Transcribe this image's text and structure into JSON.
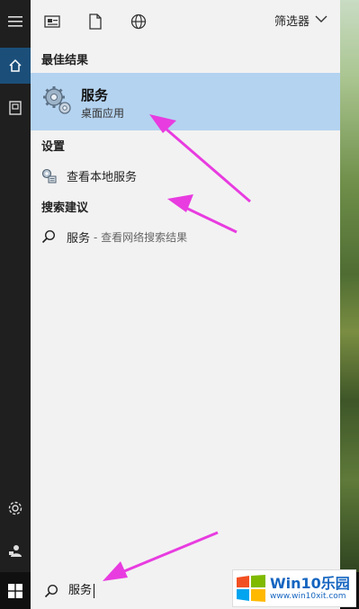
{
  "toolbar": {
    "filter_label": "筛选器",
    "icons": [
      "document-list-icon",
      "file-icon",
      "globe-icon",
      "chevron-down-icon"
    ]
  },
  "rail": {
    "icons": [
      "hamburger-menu-icon",
      "home-icon",
      "notebook-icon",
      "settings-gear-icon",
      "feedback-person-icon"
    ]
  },
  "sections": {
    "best_match": "最佳结果",
    "settings": "设置",
    "suggestions": "搜索建议"
  },
  "best_result": {
    "title": "服务",
    "subtitle": "桌面应用",
    "icon": "services-gears-icon"
  },
  "settings_item": {
    "label": "查看本地服务",
    "icon": "settings-services-icon"
  },
  "suggestion_item": {
    "label": "服务",
    "hint": "- 查看网络搜索结果",
    "icon": "search-icon"
  },
  "search": {
    "value": "服务"
  },
  "watermark": {
    "title": "Win10乐园",
    "url": "www.win10xit.com"
  },
  "colors": {
    "panel_bg": "#f2f2f2",
    "selected_bg": "#b4d3f0",
    "rail_bg": "#1f1f1f",
    "active_rail": "#1b4f7a",
    "arrow": "#e83ce0"
  }
}
